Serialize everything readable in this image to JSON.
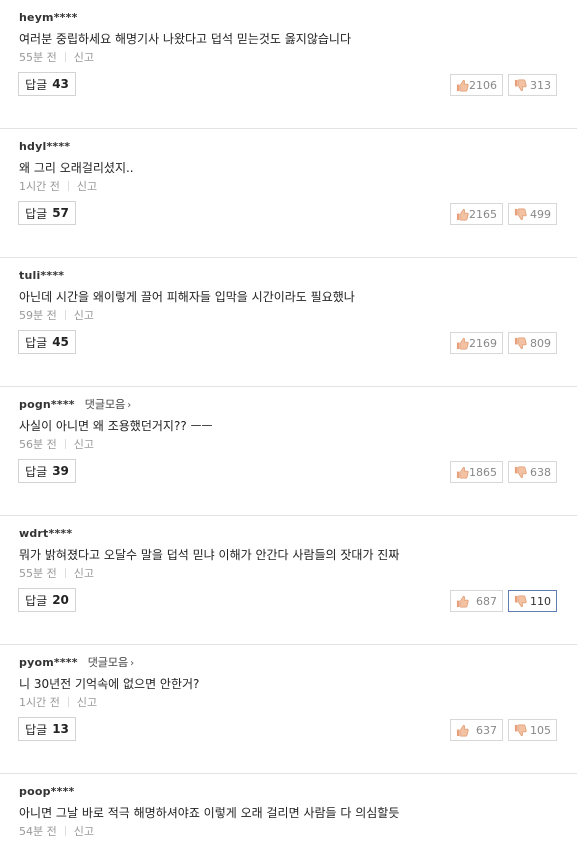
{
  "comments": [
    {
      "author": "heym****",
      "text": "여러분 중립하세요 해명기사 나왔다고 덥석 믿는것도 옳지않습니다",
      "time": "55분 전",
      "report": "신고",
      "reply_label": "답글",
      "reply_count": "43",
      "likes": "2106",
      "dislikes": "313",
      "collection": ""
    },
    {
      "author": "hdyl****",
      "text": "왜 그리 오래걸리셨지..",
      "time": "1시간 전",
      "report": "신고",
      "reply_label": "답글",
      "reply_count": "57",
      "likes": "2165",
      "dislikes": "499",
      "collection": ""
    },
    {
      "author": "tuli****",
      "text": "아닌데 시간을 왜이렇게 끌어 피해자들 입막을 시간이라도 필요했나",
      "time": "59분 전",
      "report": "신고",
      "reply_label": "답글",
      "reply_count": "45",
      "likes": "2169",
      "dislikes": "809",
      "collection": ""
    },
    {
      "author": "pogn****",
      "text": "사실이 아니면 왜 조용했던거지?? ㅡㅡ",
      "time": "56분 전",
      "report": "신고",
      "reply_label": "답글",
      "reply_count": "39",
      "likes": "1865",
      "dislikes": "638",
      "collection": "댓글모음"
    },
    {
      "author": "wdrt****",
      "text": "뭐가 밝혀졌다고 오달수 말을 덥석 믿냐 이해가 안간다 사람들의 잣대가 진짜",
      "time": "55분 전",
      "report": "신고",
      "reply_label": "답글",
      "reply_count": "20",
      "likes": "687",
      "dislikes": "110",
      "collection": "",
      "dislike_active": true
    },
    {
      "author": "pyom****",
      "text": "니 30년전 기억속에 없으면 안한거?",
      "time": "1시간 전",
      "report": "신고",
      "reply_label": "답글",
      "reply_count": "13",
      "likes": "637",
      "dislikes": "105",
      "collection": "댓글모음"
    },
    {
      "author": "poop****",
      "text": "아니면 그날 바로 적극 해명하셔야죠 이렇게 오래 걸리면 사람들 다 의심할듯",
      "time": "54분 전",
      "report": "신고",
      "collection": ""
    }
  ],
  "icons": {
    "like": "thumbs-up-icon",
    "dislike": "thumbs-down-icon",
    "chevron": "chevron-right-icon"
  },
  "colors": {
    "like_icon": "#e8a07a",
    "dislike_icon": "#e8a07a",
    "active_border": "#5e7fb3"
  }
}
